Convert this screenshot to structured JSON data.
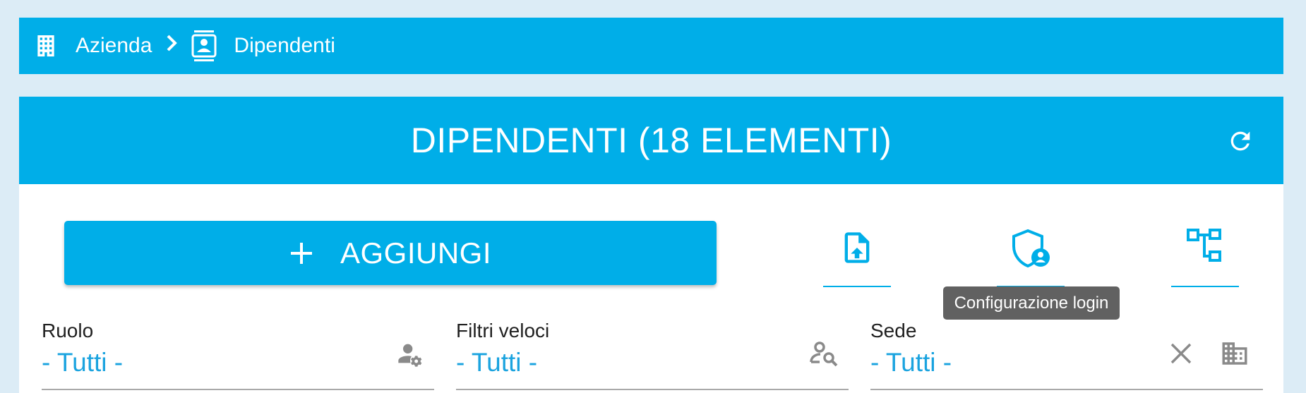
{
  "breadcrumb": {
    "items": [
      {
        "label": "Azienda",
        "icon": "office-building-icon"
      },
      {
        "label": "Dipendenti",
        "icon": "badge-account-icon"
      }
    ],
    "separator": ">"
  },
  "header": {
    "title": "DIPENDENTI (18 ELEMENTI)",
    "refresh_icon": "refresh-icon"
  },
  "toolbar": {
    "add_label": "AGGIUNGI",
    "add_icon": "plus-icon",
    "tools": [
      {
        "name": "import-file",
        "icon": "file-upload-icon"
      },
      {
        "name": "login-config",
        "icon": "shield-account-icon"
      },
      {
        "name": "org-chart",
        "icon": "family-tree-icon"
      }
    ],
    "tooltip": "Configurazione login"
  },
  "filters": [
    {
      "label": "Ruolo",
      "value": "- Tutti -",
      "icon": "account-cog-icon"
    },
    {
      "label": "Filtri veloci",
      "value": "- Tutti -",
      "icon": "account-search-icon"
    },
    {
      "label": "Sede",
      "value": "- Tutti -",
      "icon": "domain-icon",
      "clear_icon": "close-icon"
    }
  ],
  "colors": {
    "primary": "#00aee8",
    "background": "#dcecf6",
    "value_text": "#1aa3df",
    "tooltip_bg": "#616161",
    "icon_gray": "#8a8a8a"
  }
}
